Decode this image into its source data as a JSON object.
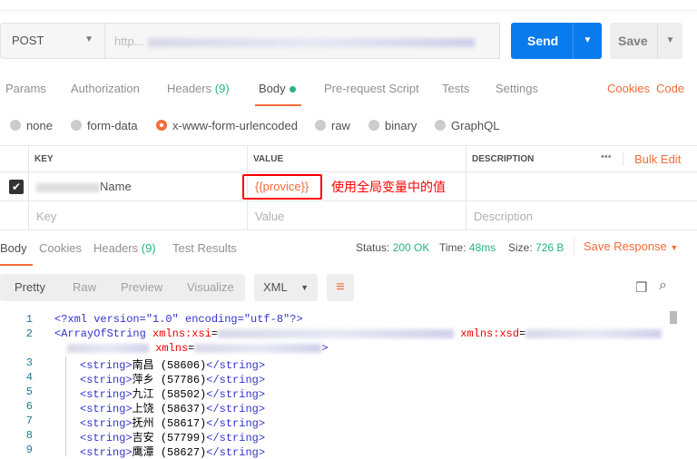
{
  "request": {
    "method": "POST",
    "url_placeholder": "http...",
    "send": "Send",
    "save": "Save"
  },
  "tabs": [
    {
      "label": "Params"
    },
    {
      "label": "Authorization"
    },
    {
      "label": "Headers",
      "count": "(9)"
    },
    {
      "label": "Body"
    },
    {
      "label": "Pre-request Script"
    },
    {
      "label": "Tests"
    },
    {
      "label": "Settings"
    }
  ],
  "tab_links": {
    "cookies": "Cookies",
    "code": "Code"
  },
  "body_types": [
    "none",
    "form-data",
    "x-www-form-urlencoded",
    "raw",
    "binary",
    "GraphQL"
  ],
  "table": {
    "headers": {
      "key": "KEY",
      "value": "VALUE",
      "description": "DESCRIPTION"
    },
    "bulk_edit": "Bulk Edit",
    "more": "•••",
    "rows": [
      {
        "key": "Name",
        "value": "{{provice}}",
        "annotation": "使用全局变量中的值"
      }
    ],
    "placeholders": {
      "key": "Key",
      "value": "Value",
      "description": "Description"
    }
  },
  "response": {
    "tabs": [
      "Body",
      "Cookies",
      "Headers",
      "Test Results"
    ],
    "headers_count": "(9)",
    "status_label": "Status:",
    "status": "200 OK",
    "time_label": "Time:",
    "time": "48ms",
    "size_label": "Size:",
    "size": "726 B",
    "save_response": "Save Response"
  },
  "view": {
    "modes": [
      "Pretty",
      "Raw",
      "Preview",
      "Visualize"
    ],
    "format": "XML"
  },
  "code": {
    "line1": "<?xml version=\"1.0\" encoding=\"utf-8\"?>",
    "items": [
      {
        "ln": "3",
        "city": "南昌",
        "id": "(58606)"
      },
      {
        "ln": "4",
        "city": "萍乡",
        "id": "(57786)"
      },
      {
        "ln": "5",
        "city": "九江",
        "id": "(58502)"
      },
      {
        "ln": "6",
        "city": "上饶",
        "id": "(58637)"
      },
      {
        "ln": "7",
        "city": "抚州",
        "id": "(58617)"
      },
      {
        "ln": "8",
        "city": "吉安",
        "id": "(57799)"
      },
      {
        "ln": "9",
        "city": "鹰潭",
        "id": "(58627)"
      }
    ]
  }
}
